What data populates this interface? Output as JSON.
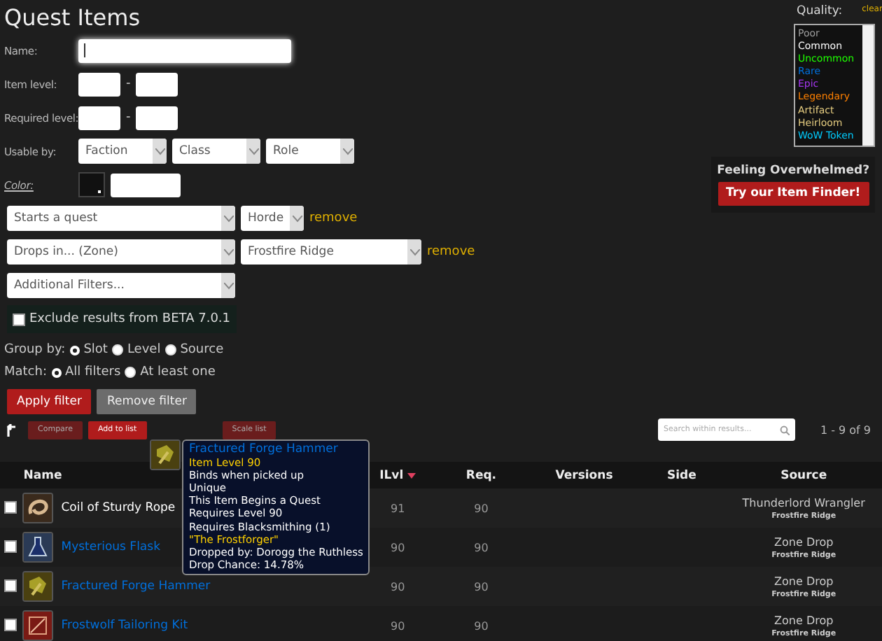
{
  "title": "Quest Items",
  "filters": {
    "name": {
      "label": "Name:"
    },
    "item_level": {
      "label": "Item level:",
      "separator": "-"
    },
    "required_level": {
      "label": "Required level:",
      "separator": "-"
    },
    "usable_by": {
      "label": "Usable by:",
      "selects": [
        "Faction",
        "Class",
        "Role"
      ]
    },
    "color": {
      "label": "Color:"
    },
    "criteria": [
      {
        "field": "Starts a quest",
        "value": "Horde",
        "remove": "remove"
      },
      {
        "field": "Drops in... (Zone)",
        "value": "Frostfire Ridge",
        "remove": "remove"
      }
    ],
    "additional": "Additional Filters...",
    "exclude": {
      "label": "Exclude results from BETA 7.0.1",
      "checked": false
    },
    "group_by": {
      "label": "Group by:",
      "options": [
        {
          "label": "Slot",
          "selected": true
        },
        {
          "label": "Level",
          "selected": false
        },
        {
          "label": "Source",
          "selected": false
        }
      ]
    },
    "match": {
      "label": "Match:",
      "options": [
        {
          "label": "All filters",
          "selected": true
        },
        {
          "label": "At least one",
          "selected": false
        }
      ]
    },
    "buttons": [
      "Apply filter",
      "Remove filter"
    ]
  },
  "quality": {
    "label": "Quality:",
    "clear": "clear",
    "items": [
      {
        "label": "Poor",
        "color": "#9d9d9d"
      },
      {
        "label": "Common",
        "color": "#ffffff"
      },
      {
        "label": "Uncommon",
        "color": "#1eff00"
      },
      {
        "label": "Rare",
        "color": "#0070dd"
      },
      {
        "label": "Epic",
        "color": "#a335ee"
      },
      {
        "label": "Legendary",
        "color": "#ff8000"
      },
      {
        "label": "Artifact",
        "color": "#e5cc80"
      },
      {
        "label": "Heirloom",
        "color": "#e5cc80"
      },
      {
        "label": "WoW Token",
        "color": "#00ccff"
      }
    ]
  },
  "promo": {
    "heading": "Feeling Overwhelmed?",
    "button": "Try our Item Finder!"
  },
  "toolbar": {
    "buttons": [
      {
        "label": "Compare",
        "disabled": true
      },
      {
        "label": "Add to list",
        "disabled": false
      },
      {
        "label": "Scale list",
        "disabled": true
      }
    ],
    "search": {
      "placeholder": "Search within results..."
    },
    "count": "1 - 9 of 9"
  },
  "table": {
    "columns": [
      "Name",
      "ILvl",
      "Req.",
      "Versions",
      "Side",
      "Source"
    ],
    "rows": [
      {
        "checked": false,
        "name": "Coil of Sturdy Rope",
        "color": "#ffffff",
        "ilvl": "91",
        "req": "90",
        "source": "Thunderlord Wrangler",
        "zone": "Frostfire Ridge"
      },
      {
        "checked": false,
        "name": "Mysterious Flask",
        "color": "#0070dd",
        "ilvl": "90",
        "req": "90",
        "source": "Zone Drop",
        "zone": "Frostfire Ridge"
      },
      {
        "checked": false,
        "name": "Fractured Forge Hammer",
        "color": "#0070dd",
        "ilvl": "90",
        "req": "90",
        "source": "Zone Drop",
        "zone": "Frostfire Ridge"
      },
      {
        "checked": false,
        "name": "Frostwolf Tailoring Kit",
        "color": "#0070dd",
        "ilvl": "90",
        "req": "90",
        "source": "Zone Drop",
        "zone": "Frostfire Ridge"
      }
    ]
  },
  "tooltip": {
    "lines": [
      {
        "text": "Fractured Forge Hammer",
        "color": "#0070dd"
      },
      {
        "text": "Item Level 90",
        "color": "#ffd100"
      },
      {
        "text": "Binds when picked up",
        "color": "#ffffff"
      },
      {
        "text": "Unique",
        "color": "#ffffff"
      },
      {
        "text": "This Item Begins a Quest",
        "color": "#ffffff"
      },
      {
        "text": "Requires Level 90",
        "color": "#ffffff"
      },
      {
        "text": "Requires Blacksmithing (1)",
        "color": "#ffffff"
      },
      {
        "text": "\"The Frostforger\"",
        "color": "#ffd100"
      },
      {
        "text": "Dropped by: Dorogg the Ruthless",
        "color": "#ffffff"
      },
      {
        "text": "Drop Chance: 14.78%",
        "color": "#ffffff"
      }
    ]
  }
}
